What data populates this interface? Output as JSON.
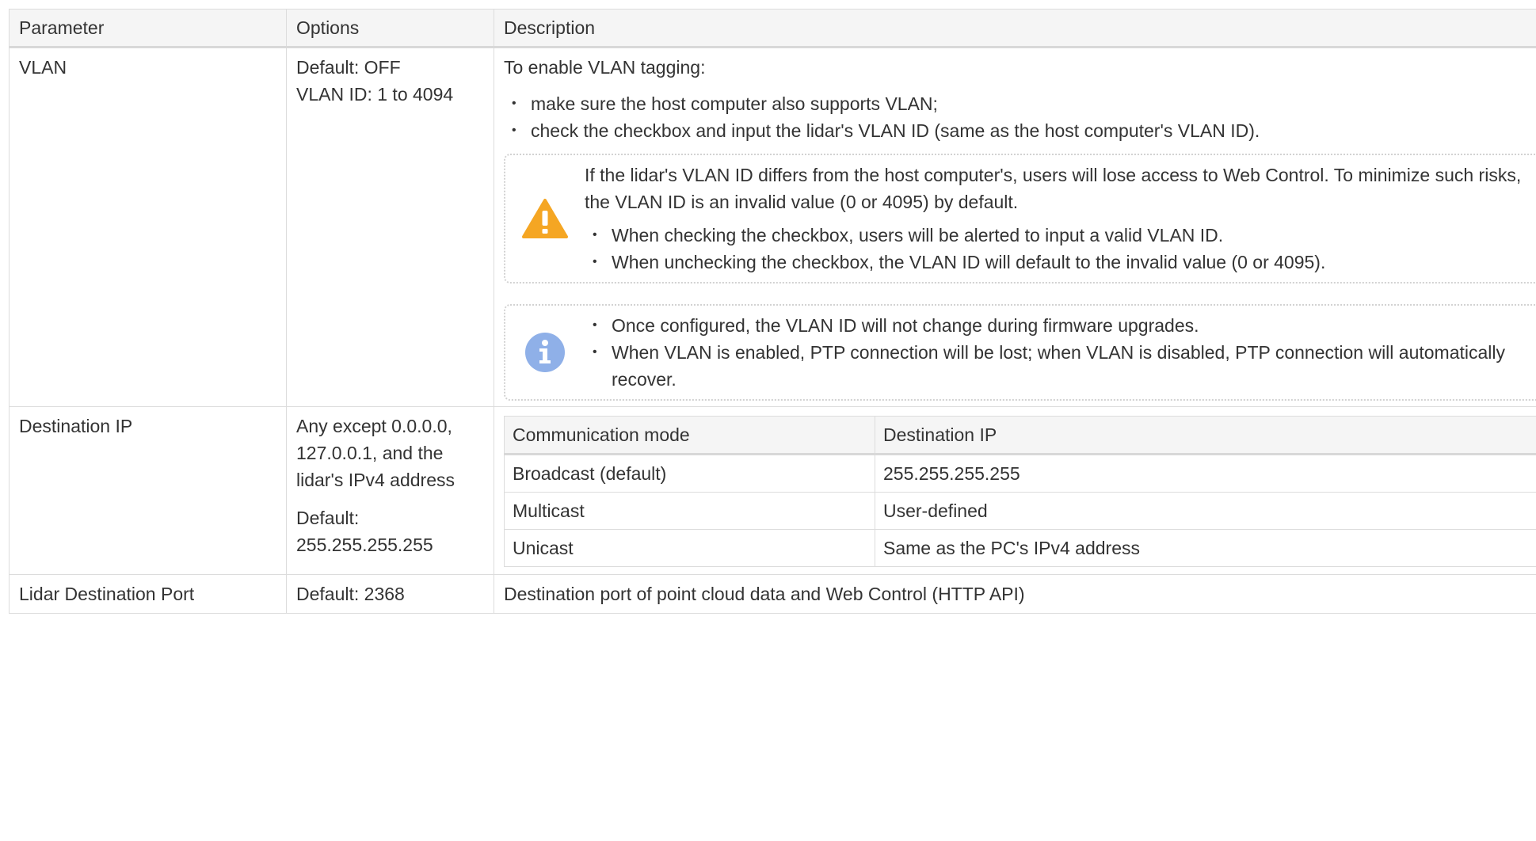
{
  "columns": [
    "Parameter",
    "Options",
    "Description"
  ],
  "vlan": {
    "name": "VLAN",
    "options": [
      "Default: OFF",
      "VLAN ID: 1 to 4094"
    ],
    "intro": "To enable VLAN tagging:",
    "bullets": [
      "make sure the host computer also supports VLAN;",
      "check the checkbox and input the lidar's VLAN ID (same as the host computer's VLAN ID)."
    ],
    "warning": {
      "icon": "warning-icon",
      "color": "#f5a623",
      "text": "If the lidar's VLAN ID differs from the host computer's, users will lose access to Web Control. To minimize such risks, the VLAN ID is an invalid value (0 or 4095) by default.",
      "bullets": [
        "When checking the checkbox, users will be alerted to input a valid VLAN ID.",
        "When unchecking the checkbox, the VLAN ID will default to the invalid value (0 or 4095)."
      ]
    },
    "info": {
      "icon": "info-icon",
      "color": "#8fb0e8",
      "bullets": [
        "Once configured, the VLAN ID will not change during firmware upgrades.",
        "When VLAN is enabled, PTP connection will be lost; when VLAN is disabled, PTP connection will automatically recover."
      ]
    }
  },
  "destination_ip": {
    "name": "Destination IP",
    "options_line": "Any except 0.0.0.0, 127.0.0.1, and the lidar's IPv4 address",
    "default_label": "Default:",
    "default_value": "255.255.255.255",
    "table": {
      "headers": [
        "Communication mode",
        "Destination IP"
      ],
      "rows": [
        [
          "Broadcast (default)",
          "255.255.255.255"
        ],
        [
          "Multicast",
          "User-defined"
        ],
        [
          "Unicast",
          "Same as the PC's IPv4 address"
        ]
      ]
    }
  },
  "lidar_port": {
    "name": "Lidar Destination Port",
    "options": "Default: 2368",
    "description": "Destination port of point cloud data and Web Control (HTTP API)"
  }
}
